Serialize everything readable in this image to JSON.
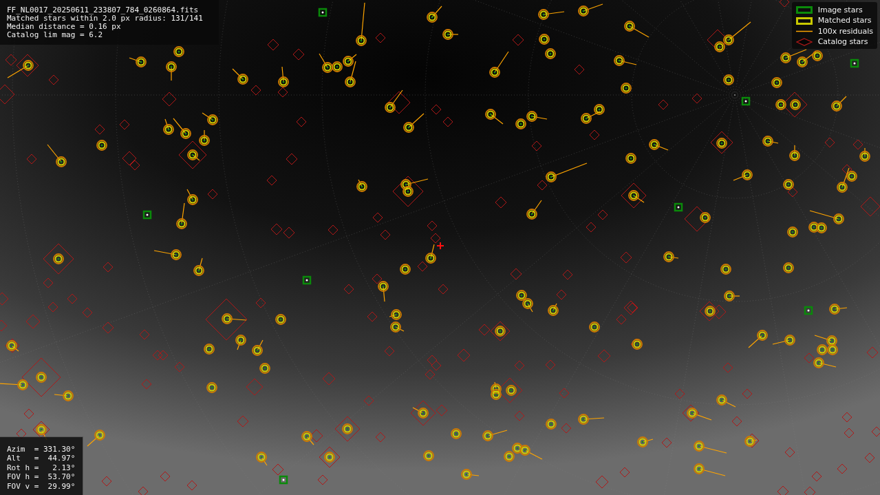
{
  "file_info": {
    "lines": [
      "FF_NL0017_20250611_233807_784_0260864.fits",
      "Matched stars within 2.0 px radius: 131/141",
      "Median distance = 0.16 px",
      "Catalog lim mag = 6.2"
    ]
  },
  "legend": {
    "items": [
      {
        "kind": "image",
        "label": "Image stars"
      },
      {
        "kind": "matched",
        "label": "Matched stars"
      },
      {
        "kind": "residual",
        "label": "100x residuals"
      },
      {
        "kind": "catalog",
        "label": "Catalog stars"
      }
    ]
  },
  "pointing": {
    "lines": [
      "Azim  = 331.30°",
      "Alt   =  44.97°",
      "Rot h =   2.13°",
      "FOV h =  53.70°",
      "FOV v =  29.99°"
    ]
  }
}
